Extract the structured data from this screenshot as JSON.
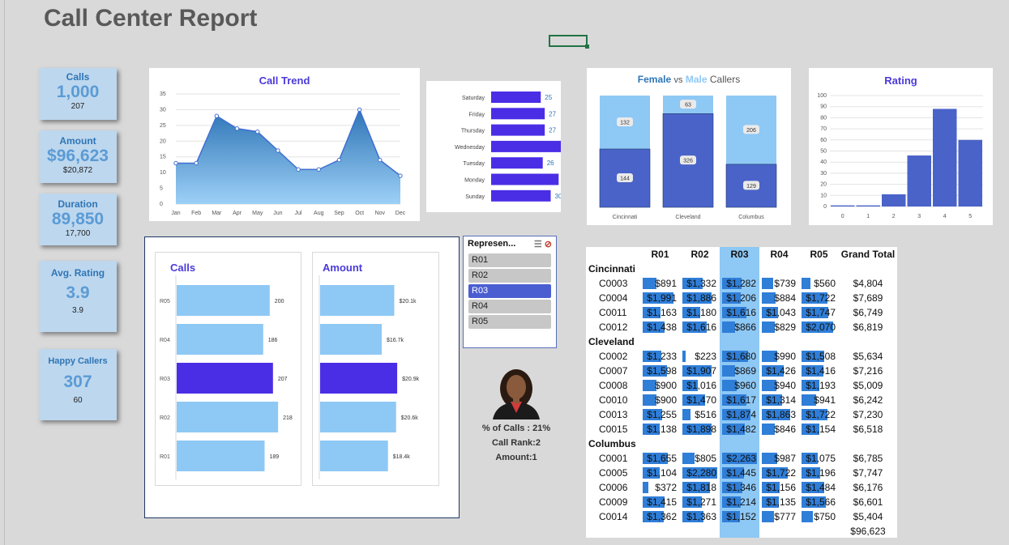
{
  "title": "Call Center Report",
  "kpis": [
    {
      "label": "Calls",
      "value": "1,000",
      "sub": "207"
    },
    {
      "label": "Amount",
      "value": "$96,623",
      "sub": "$20,872"
    },
    {
      "label": "Duration",
      "value": "89,850",
      "sub": "17,700"
    },
    {
      "label": "Avg. Rating",
      "value": "3.9",
      "sub": "3.9"
    },
    {
      "label": "Happy Callers",
      "value": "307",
      "sub": "60"
    }
  ],
  "call_trend": {
    "title": "Call Trend"
  },
  "gender": {
    "title_female": "Female",
    "title_vs": "vs",
    "title_male": "Male",
    "title_callers": "Callers"
  },
  "rating": {
    "title": "Rating"
  },
  "rep_calls": {
    "title": "Calls"
  },
  "rep_amount": {
    "title": "Amount"
  },
  "slicer": {
    "title": "Represen...",
    "items": [
      "R01",
      "R02",
      "R03",
      "R04",
      "R05"
    ],
    "selected": "R03"
  },
  "rep_card": {
    "pct": "% of Calls : 21%",
    "rank": "Call Rank:2",
    "amount": "Amount:1"
  },
  "pivot": {
    "headers": [
      "",
      "R01",
      "R02",
      "R03",
      "R04",
      "R05",
      "Grand Total"
    ],
    "groups": [
      {
        "name": "Cincinnati",
        "rows": [
          {
            "id": "C0003",
            "v": [
              "$891",
              "$1,332",
              "$1,282",
              "$739",
              "$560"
            ],
            "t": "$4,804"
          },
          {
            "id": "C0004",
            "v": [
              "$1,991",
              "$1,886",
              "$1,206",
              "$884",
              "$1,722"
            ],
            "t": "$7,689"
          },
          {
            "id": "C0011",
            "v": [
              "$1,163",
              "$1,180",
              "$1,616",
              "$1,043",
              "$1,747"
            ],
            "t": "$6,749"
          },
          {
            "id": "C0012",
            "v": [
              "$1,438",
              "$1,616",
              "$866",
              "$829",
              "$2,070"
            ],
            "t": "$6,819"
          }
        ]
      },
      {
        "name": "Cleveland",
        "rows": [
          {
            "id": "C0002",
            "v": [
              "$1,233",
              "$223",
              "$1,680",
              "$990",
              "$1,508"
            ],
            "t": "$5,634"
          },
          {
            "id": "C0007",
            "v": [
              "$1,598",
              "$1,907",
              "$869",
              "$1,426",
              "$1,416"
            ],
            "t": "$7,216"
          },
          {
            "id": "C0008",
            "v": [
              "$900",
              "$1,016",
              "$960",
              "$940",
              "$1,193"
            ],
            "t": "$5,009"
          },
          {
            "id": "C0010",
            "v": [
              "$900",
              "$1,470",
              "$1,617",
              "$1,314",
              "$941"
            ],
            "t": "$6,242"
          },
          {
            "id": "C0013",
            "v": [
              "$1,255",
              "$516",
              "$1,874",
              "$1,863",
              "$1,722"
            ],
            "t": "$7,230"
          },
          {
            "id": "C0015",
            "v": [
              "$1,138",
              "$1,898",
              "$1,482",
              "$846",
              "$1,154"
            ],
            "t": "$6,518"
          }
        ]
      },
      {
        "name": "Columbus",
        "rows": [
          {
            "id": "C0001",
            "v": [
              "$1,655",
              "$805",
              "$2,263",
              "$987",
              "$1,075"
            ],
            "t": "$6,785"
          },
          {
            "id": "C0005",
            "v": [
              "$1,104",
              "$2,280",
              "$1,445",
              "$1,722",
              "$1,196"
            ],
            "t": "$7,747"
          },
          {
            "id": "C0006",
            "v": [
              "$372",
              "$1,818",
              "$1,346",
              "$1,156",
              "$1,484"
            ],
            "t": "$6,176"
          },
          {
            "id": "C0009",
            "v": [
              "$1,415",
              "$1,271",
              "$1,214",
              "$1,135",
              "$1,566"
            ],
            "t": "$6,601"
          },
          {
            "id": "C0014",
            "v": [
              "$1,362",
              "$1,363",
              "$1,152",
              "$777",
              "$750"
            ],
            "t": "$5,404"
          }
        ]
      }
    ],
    "grand_total": "$96,623"
  },
  "chart_data": [
    {
      "type": "area",
      "title": "Call Trend",
      "categories": [
        "Jan",
        "Feb",
        "Mar",
        "Apr",
        "May",
        "Jun",
        "Jul",
        "Aug",
        "Sep",
        "Oct",
        "Nov",
        "Dec"
      ],
      "values": [
        13,
        13,
        28,
        24,
        23,
        17,
        11,
        11,
        14,
        30,
        14,
        9
      ],
      "ylim": [
        0,
        35
      ],
      "yticks": [
        0,
        5,
        10,
        15,
        20,
        25,
        30,
        35
      ],
      "color": "#5b9bd5"
    },
    {
      "type": "bar",
      "orientation": "horizontal",
      "categories": [
        "Saturday",
        "Friday",
        "Thursday",
        "Wednesday",
        "Tuesday",
        "Monday",
        "Sunday"
      ],
      "values": [
        25,
        27,
        27,
        38,
        26,
        34,
        30
      ],
      "color": "#4a2ee6"
    },
    {
      "type": "bar",
      "stacked": true,
      "categories": [
        "Cincinnati",
        "Cleveland",
        "Columbus"
      ],
      "series": [
        {
          "name": "Male",
          "values": [
            144,
            326,
            129
          ],
          "color": "#4a63c9"
        },
        {
          "name": "Female",
          "values": [
            132,
            63,
            206
          ],
          "color": "#8ec8f5"
        }
      ]
    },
    {
      "type": "bar",
      "title": "Rating",
      "categories": [
        "0",
        "1",
        "2",
        "3",
        "4",
        "5"
      ],
      "values": [
        1,
        1,
        11,
        46,
        88,
        60
      ],
      "ylim": [
        0,
        100
      ],
      "yticks": [
        0,
        10,
        20,
        30,
        40,
        50,
        60,
        70,
        80,
        90,
        100
      ],
      "color": "#4a63c9"
    },
    {
      "type": "bar",
      "orientation": "horizontal",
      "title": "Calls",
      "categories": [
        "R05",
        "R04",
        "R03",
        "R02",
        "R01"
      ],
      "values": [
        200,
        186,
        207,
        218,
        189
      ],
      "labels": [
        "200",
        "186",
        "207",
        "218",
        "189"
      ],
      "highlight": "R03"
    },
    {
      "type": "bar",
      "orientation": "horizontal",
      "title": "Amount",
      "categories": [
        "R05",
        "R04",
        "R03",
        "R02",
        "R01"
      ],
      "values": [
        20.1,
        16.7,
        20.9,
        20.6,
        18.4
      ],
      "labels": [
        "$20.1k",
        "$16.7k",
        "$20.9k",
        "$20.6k",
        "$18.4k"
      ],
      "highlight": "R03"
    }
  ]
}
